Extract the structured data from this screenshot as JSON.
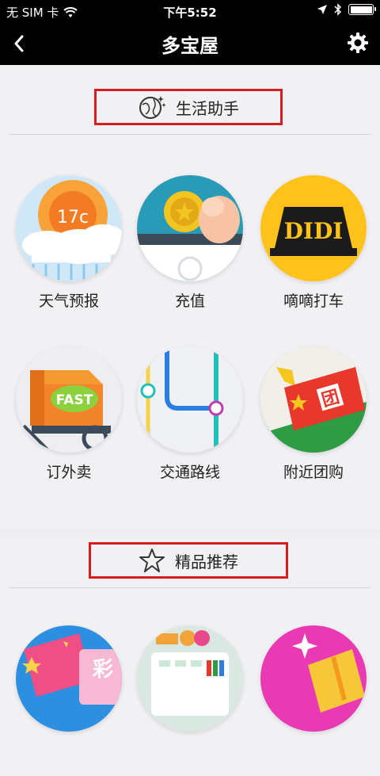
{
  "status_bar": {
    "carrier": "无 SIM 卡",
    "time": "下午5:52",
    "icons": [
      "wifi-icon",
      "location-arrow-icon",
      "bluetooth-icon",
      "battery-icon"
    ]
  },
  "nav": {
    "title": "多宝屋",
    "back_icon": "chevron-left-icon",
    "settings_icon": "gear-icon"
  },
  "sections": [
    {
      "title": "生活助手",
      "icon": "globe-sparkle-icon",
      "items": [
        {
          "label": "天气预报",
          "icon": "weather-icon",
          "badge": "17c"
        },
        {
          "label": "充值",
          "icon": "coin-recharge-icon"
        },
        {
          "label": "嘀嘀打车",
          "icon": "didi-taxi-icon",
          "badge": "DIDI"
        },
        {
          "label": "订外卖",
          "icon": "delivery-box-icon",
          "badge": "FAST"
        },
        {
          "label": "交通路线",
          "icon": "subway-map-icon"
        },
        {
          "label": "附近团购",
          "icon": "group-buy-ticket-icon",
          "badge": "团"
        }
      ]
    },
    {
      "title": "精品推荐",
      "icon": "star-outline-icon",
      "items": [
        {
          "icon": "lottery-icon",
          "badge": "彩"
        },
        {
          "icon": "app-grid-icon"
        },
        {
          "icon": "gift-sparkle-icon"
        }
      ]
    }
  ],
  "colors": {
    "highlight_frame": "#d71c1f",
    "background": "#f1f1f4",
    "bar": "#000000"
  }
}
